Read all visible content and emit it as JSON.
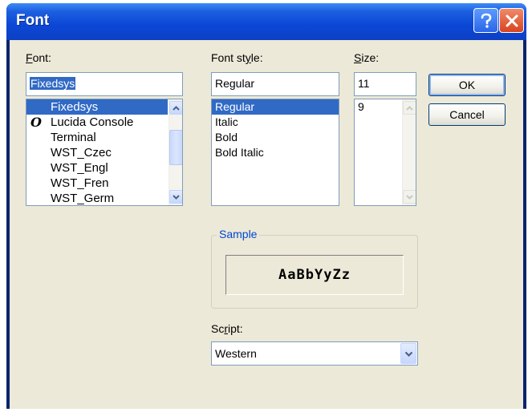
{
  "window": {
    "title": "Font",
    "help_label": "?",
    "close_label": "×"
  },
  "font": {
    "label": "Font:",
    "value": "Fixedsys",
    "items": [
      {
        "name": "Fixedsys",
        "selected": true,
        "truetype": false
      },
      {
        "name": "Lucida Console",
        "selected": false,
        "truetype": true
      },
      {
        "name": "Terminal",
        "selected": false,
        "truetype": false
      },
      {
        "name": "WST_Czec",
        "selected": false,
        "truetype": false
      },
      {
        "name": "WST_Engl",
        "selected": false,
        "truetype": false
      },
      {
        "name": "WST_Fren",
        "selected": false,
        "truetype": false
      },
      {
        "name": "WST_Germ",
        "selected": false,
        "truetype": false
      }
    ],
    "truetype_glyph": "O"
  },
  "style": {
    "label": "Font style:",
    "value": "Regular",
    "items": [
      "Regular",
      "Italic",
      "Bold",
      "Bold Italic"
    ],
    "selected": "Regular"
  },
  "size": {
    "label": "Size:",
    "value": "11",
    "items": [
      "9"
    ]
  },
  "buttons": {
    "ok": "OK",
    "cancel": "Cancel"
  },
  "sample": {
    "title": "Sample",
    "text": "AaBbYyZz"
  },
  "script": {
    "label": "Script:",
    "value": "Western"
  },
  "colors": {
    "selection": "#316ac5",
    "dialog_bg": "#ece9d8",
    "titlebar": "#0b47d6",
    "group_title": "#0046d5"
  }
}
